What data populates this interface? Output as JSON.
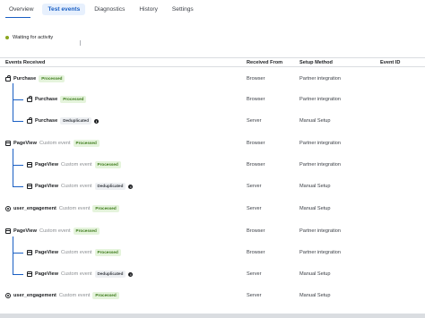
{
  "tabs": [
    "Overview",
    "Test events",
    "Diagnostics",
    "History",
    "Settings"
  ],
  "activity_status": "Waiting for activity",
  "columns": {
    "events_received": "Events Received",
    "received_from": "Received From",
    "setup_method": "Setup Method",
    "event_id": "Event ID"
  },
  "rows": [
    {
      "name": "Purchase",
      "sub": "",
      "badge": "Processed",
      "from": "Browser",
      "method": "Partner integration",
      "icon": "shopping-bag-icon"
    },
    {
      "name": "Purchase",
      "sub": "",
      "badge": "Processed",
      "from": "Browser",
      "method": "Partner integration",
      "icon": "shopping-bag-icon"
    },
    {
      "name": "Purchase",
      "sub": "",
      "badge": "Deduplicated",
      "from": "Server",
      "method": "Manual Setup",
      "icon": "shopping-bag-icon"
    },
    {
      "name": "PageView",
      "sub": "Custom event",
      "badge": "Processed",
      "from": "Browser",
      "method": "Partner integration",
      "icon": "page-icon"
    },
    {
      "name": "PageView",
      "sub": "Custom event",
      "badge": "Processed",
      "from": "Browser",
      "method": "Partner integration",
      "icon": "page-icon"
    },
    {
      "name": "PageView",
      "sub": "Custom event",
      "badge": "Deduplicated",
      "from": "Server",
      "method": "Manual Setup",
      "icon": "page-icon"
    },
    {
      "name": "user_engagement",
      "sub": "Custom event",
      "badge": "Processed",
      "from": "Server",
      "method": "Manual Setup",
      "icon": "gear-icon"
    },
    {
      "name": "PageView",
      "sub": "Custom event",
      "badge": "Processed",
      "from": "Browser",
      "method": "Partner integration",
      "icon": "page-icon"
    },
    {
      "name": "PageView",
      "sub": "Custom event",
      "badge": "Processed",
      "from": "Browser",
      "method": "Partner integration",
      "icon": "page-icon"
    },
    {
      "name": "PageView",
      "sub": "Custom event",
      "badge": "Deduplicated",
      "from": "Server",
      "method": "Manual Setup",
      "icon": "page-icon"
    },
    {
      "name": "user_engagement",
      "sub": "Custom event",
      "badge": "Processed",
      "from": "Server",
      "method": "Manual Setup",
      "icon": "gear-icon"
    }
  ]
}
